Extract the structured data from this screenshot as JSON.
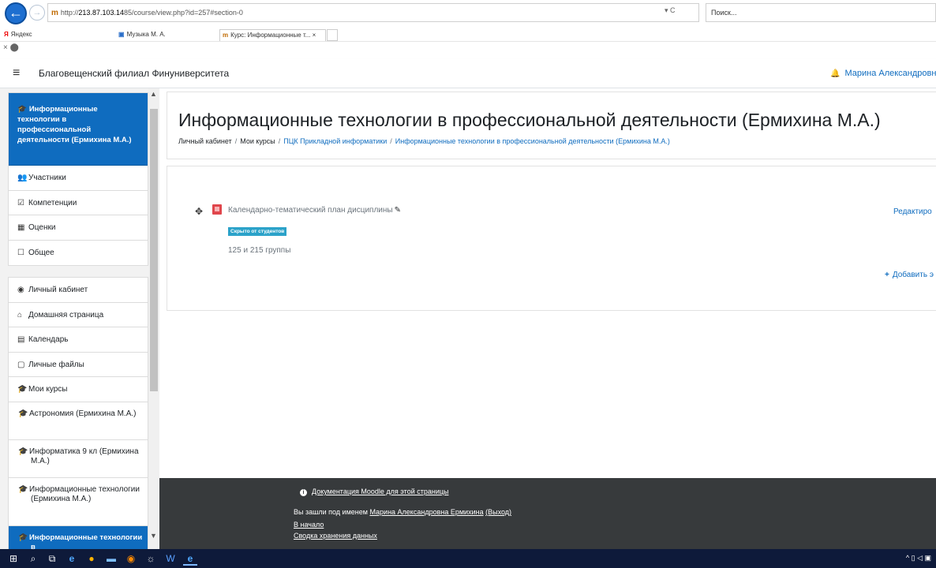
{
  "browser": {
    "url_scheme": "http://",
    "url_host": "213.87.103.14",
    "url_rest": "85/course/view.php?id=257#section-0",
    "url_controls": "▾ C",
    "search_placeholder": "Поиск...",
    "tabs": [
      {
        "label": "Яндекс",
        "icon": "yandex-icon"
      },
      {
        "label": "Музыка М. А.",
        "icon": "mail-icon"
      },
      {
        "label": "Курс: Информационные т...",
        "icon": "moodle-icon",
        "active": true
      }
    ],
    "tab_close": "×",
    "bar2": "× ⬤"
  },
  "navbar": {
    "menu_icon": "≡",
    "site_name": "Благовещенский филиал Финуниверситета",
    "user_name": "Марина Александровн"
  },
  "drawer": {
    "course_heading": "Информационные технологии в профессиональной деятельности (Ермихина М.А.)",
    "course_items": [
      {
        "label": "Участники",
        "icon": "users-icon",
        "glyph": "👥"
      },
      {
        "label": "Компетенции",
        "icon": "checkbox-icon",
        "glyph": "☑"
      },
      {
        "label": "Оценки",
        "icon": "table-icon",
        "glyph": "▦"
      },
      {
        "label": "Общее",
        "icon": "folder-icon",
        "glyph": "☐"
      }
    ],
    "site_items": [
      {
        "label": "Личный кабинет",
        "icon": "dashboard-icon",
        "glyph": "◉"
      },
      {
        "label": "Домашняя страница",
        "icon": "home-icon",
        "glyph": "⌂"
      },
      {
        "label": "Календарь",
        "icon": "calendar-icon",
        "glyph": "▤"
      },
      {
        "label": "Личные файлы",
        "icon": "file-icon",
        "glyph": "▢"
      },
      {
        "label": "Мои курсы",
        "icon": "graduation-cap-icon",
        "glyph": "🎓"
      }
    ],
    "my_courses": [
      {
        "label": "Астрономия (Ермихина М.А.)"
      },
      {
        "label": "Информатика 9 кл (Ермихина М.А.)"
      },
      {
        "label": "Информационные технологии (Ермихина М.А.)"
      },
      {
        "label": "Информационные технологии в",
        "active": true
      }
    ]
  },
  "page": {
    "title": "Информационные технологии в профессиональной деятельности (Ермихина М.А.)",
    "breadcrumb": [
      "Личный кабинет",
      "Мои курсы",
      "ПЦК Прикладной информатики",
      "Информационные технологии в профессиональной деятельности (Ермихина М.А.)"
    ],
    "breadcrumb_separator": "/"
  },
  "section": {
    "activity_name": "Календарно-тематический план дисциплины",
    "badge": "Скрыто от студентов",
    "description": "125 и 215 группы",
    "edit_label": "Редактиро",
    "add_label": "Добавить э"
  },
  "footer": {
    "doc_link": "Документация Moodle для этой страницы",
    "logged_in_prefix": "Вы зашли под именем",
    "logged_in_user": "Марина Александровна Ермихина",
    "logout": "(Выход)",
    "home": "В начало",
    "data_summary": "Сводка хранения данных"
  },
  "colors": {
    "brand": "#0f6cbf",
    "badge": "#2ba2c9",
    "footer_bg": "#373a3c",
    "taskbar": "#0e1a3a"
  }
}
